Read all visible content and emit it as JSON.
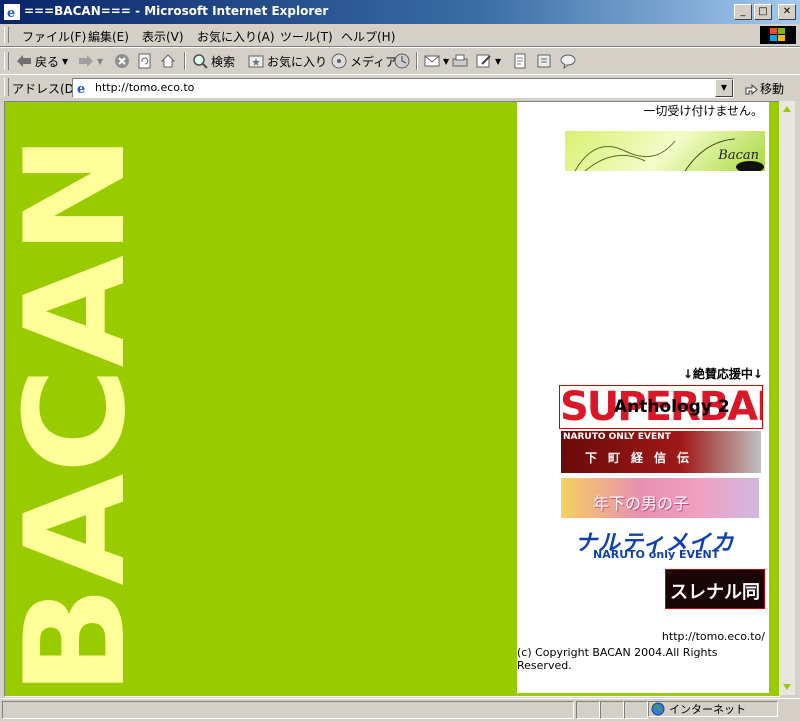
{
  "window": {
    "title": "===BACAN=== - Microsoft Internet Explorer",
    "minimize": "_",
    "maximize": "□",
    "close": "✕"
  },
  "menu": {
    "items": [
      "ファイル(F)",
      "編集(E)",
      "表示(V)",
      "お気に入り(A)",
      "ツール(T)",
      "ヘルプ(H)"
    ]
  },
  "toolbar": {
    "back_label": "戻る",
    "search_label": "検索",
    "favorites_label": "お気に入り",
    "media_label": "メディア"
  },
  "address": {
    "label": "アドレス(D)",
    "url": "http://tomo.eco.to",
    "go_label": "移動"
  },
  "page": {
    "logo_text": "BACAN",
    "notice": "一切受け付けません。",
    "main_banner_text": "Bacan",
    "support_heading": "↓絶賛応援中↓",
    "banners": [
      {
        "big": "SUPERBAD",
        "overlay": "Anthology 2"
      },
      {
        "line1": "NARUTO ONLY EVENT",
        "line2": "下町経信伝"
      },
      {
        "text": "年下の男の子"
      },
      {
        "line1": "ナルティメイカー",
        "line2": "NARUTO only EVENT"
      },
      {
        "text": "スレナル同盟"
      }
    ],
    "footer_url": "http://tomo.eco.to/",
    "copyright": "(c) Copyright BACAN 2004.All Rights Reserved."
  },
  "status": {
    "zone": "インターネット"
  },
  "colors": {
    "page_bg": "#99cc00",
    "logo": "#ffff99",
    "titlebar": "#0a246a"
  }
}
